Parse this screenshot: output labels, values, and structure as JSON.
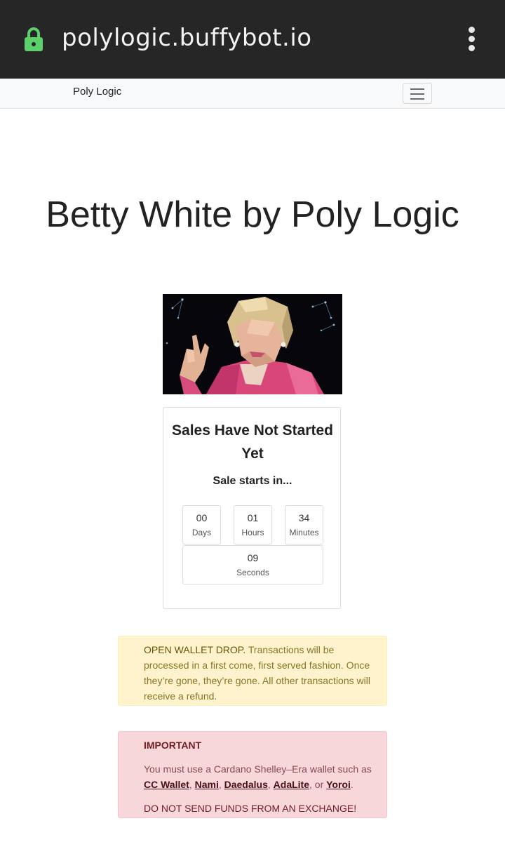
{
  "browser": {
    "url": "polylogic.buffybot.io",
    "lock_icon": "lock-icon",
    "menu_icon": "kebab-menu-icon",
    "lock_color": "#5cd16b"
  },
  "navbar": {
    "brand": "Poly Logic",
    "toggle_icon": "hamburger-icon"
  },
  "page": {
    "title": "Betty White by Poly Logic"
  },
  "sale_card": {
    "title": "Sales Have Not Started Yet",
    "subtitle": "Sale starts in...",
    "countdown": [
      {
        "value": "00",
        "label": "Days"
      },
      {
        "value": "01",
        "label": "Hours"
      },
      {
        "value": "34",
        "label": "Minutes"
      },
      {
        "value": "09",
        "label": "Seconds"
      }
    ]
  },
  "notice": {
    "lead": "OPEN WALLET DROP.",
    "text": " Transactions will be processed in a first come, first served fashion. Once they’re gone, they’re gone. All other transactions will receive a refund."
  },
  "important": {
    "heading": "IMPORTANT",
    "intro": "You must use a Cardano Shelley–Era wallet such as ",
    "wallets": [
      "CC Wallet",
      "Nami",
      "Daedalus",
      "AdaLite",
      "Yoroi"
    ],
    "sep": ", ",
    "or_text": ", or ",
    "end": ".",
    "warning": "DO NOT SEND FUNDS FROM AN EXCHANGE!"
  }
}
